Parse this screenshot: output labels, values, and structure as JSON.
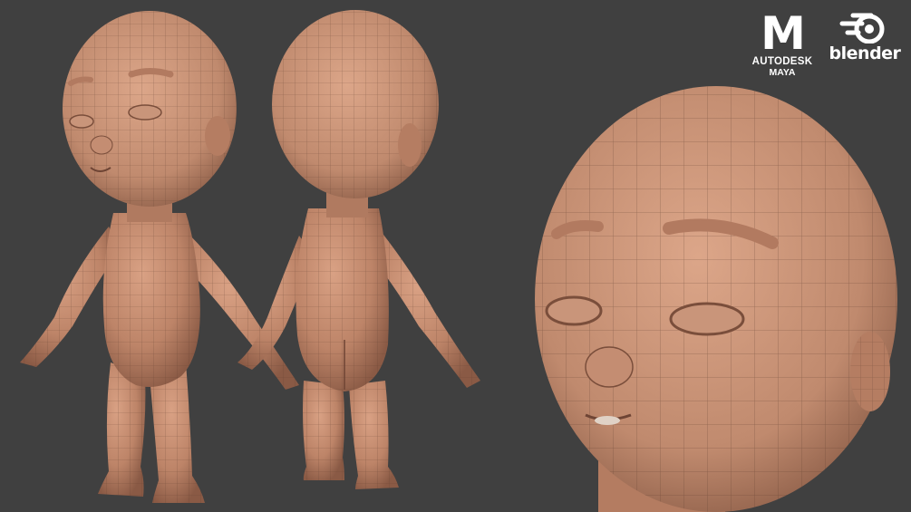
{
  "logos": {
    "maya": {
      "mark": "M",
      "line1": "AUTODESK",
      "line2": "MAYA"
    },
    "blender": {
      "icon": "blender-icon",
      "wordmark": "blender"
    }
  },
  "colors": {
    "background": "#404040",
    "skin": "#c08a6e",
    "wireframe": "#5a3a2c",
    "logo": "#ffffff"
  }
}
